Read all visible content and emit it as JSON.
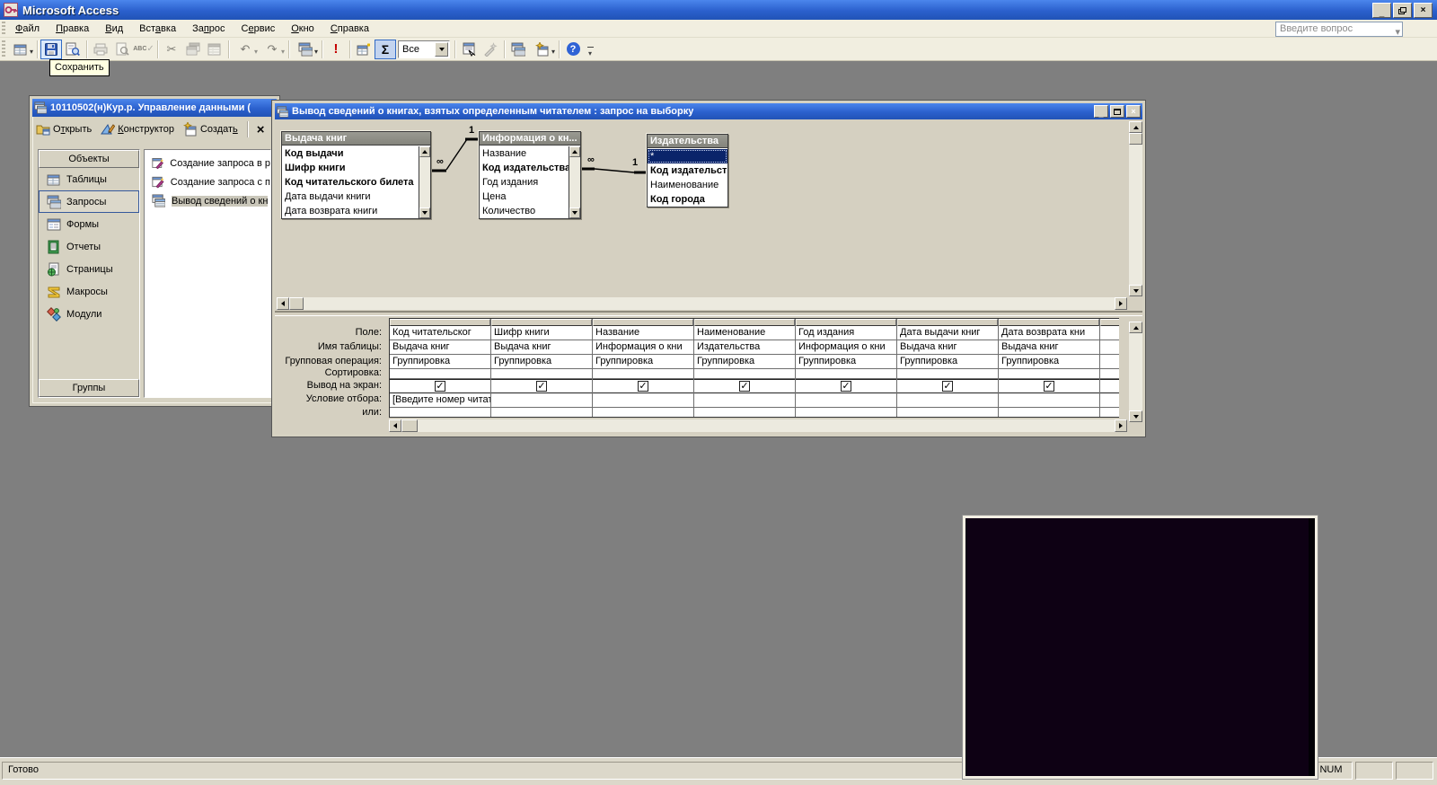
{
  "app": {
    "title": "Microsoft Access",
    "question_box": "Введите вопрос",
    "tooltip_save": "Сохранить",
    "status_ready": "Готово",
    "status_num": "NUM"
  },
  "glyphs": {
    "dropdown": "▾",
    "run": "!",
    "sigma": "Σ",
    "help": "?",
    "cut": "✂",
    "undo": "↶",
    "redo": "↷",
    "close": "×",
    "check": "✓",
    "abc": "ABC"
  },
  "menu": {
    "items": [
      {
        "pre": "",
        "u": "Ф",
        "post": "айл"
      },
      {
        "pre": "",
        "u": "П",
        "post": "равка"
      },
      {
        "pre": "",
        "u": "В",
        "post": "ид"
      },
      {
        "pre": "Вст",
        "u": "а",
        "post": "вка"
      },
      {
        "pre": "За",
        "u": "п",
        "post": "рос"
      },
      {
        "pre": "С",
        "u": "е",
        "post": "рвис"
      },
      {
        "pre": "",
        "u": "О",
        "post": "кно"
      },
      {
        "pre": "",
        "u": "С",
        "post": "правка"
      }
    ]
  },
  "toolbar": {
    "all_combo": "Все"
  },
  "db": {
    "title": "10110502(н)Кур.р. Управление данными (",
    "open_btn": {
      "pre": "О",
      "u": "т",
      "post": "крыть"
    },
    "design_btn": {
      "pre": "",
      "u": "К",
      "post": "онструктор"
    },
    "create_btn": {
      "pre": "Создат",
      "u": "ь",
      "post": ""
    },
    "objects_header": "Объекты",
    "groups_header": "Группы",
    "nav": [
      "Таблицы",
      "Запросы",
      "Формы",
      "Отчеты",
      "Страницы",
      "Макросы",
      "Модули"
    ],
    "items": [
      "Создание запроса в р",
      "Создание запроса с п",
      "Вывод сведений о кн"
    ]
  },
  "query": {
    "title": "Вывод сведений о книгах, взятых определенным читателем : запрос на выборку",
    "join_one": "1",
    "join_many": "∞",
    "tables": [
      {
        "title": "Выдача книг",
        "fields": [
          "Код выдачи",
          "Шифр книги",
          "Код читательского билета",
          "Дата выдачи книги",
          "Дата возврата книги"
        ]
      },
      {
        "title": "Информация о кн...",
        "fields": [
          "Название",
          "Код издательства",
          "Год издания",
          "Цена",
          "Количество"
        ]
      },
      {
        "title": "Издательства",
        "fields": [
          "*",
          "Код издательст",
          "Наименование",
          "Код города"
        ]
      }
    ],
    "grid": {
      "labels": [
        "Поле:",
        "Имя таблицы:",
        "Групповая операция:",
        "Сортировка:",
        "Вывод на экран:",
        "Условие отбора:",
        "или:"
      ],
      "cols": [
        {
          "field": "Код читательског",
          "table": "Выдача книг",
          "group": "Группировка",
          "criteria": "[Введите номер читат"
        },
        {
          "field": "Шифр книги",
          "table": "Выдача книг",
          "group": "Группировка",
          "criteria": ""
        },
        {
          "field": "Название",
          "table": "Информация о кни",
          "group": "Группировка",
          "criteria": ""
        },
        {
          "field": "Наименование",
          "table": "Издательства",
          "group": "Группировка",
          "criteria": ""
        },
        {
          "field": "Год издания",
          "table": "Информация о кни",
          "group": "Группировка",
          "criteria": ""
        },
        {
          "field": "Дата выдачи книг",
          "table": "Выдача книг",
          "group": "Группировка",
          "criteria": ""
        },
        {
          "field": "Дата возврата кни",
          "table": "Выдача книг",
          "group": "Группировка",
          "criteria": ""
        }
      ]
    }
  },
  "colors": {
    "titlebar_blue": "#2b60cd",
    "workspace_gray": "#7f7f7f",
    "chrome_beige": "#d6d2c2",
    "selection_navy": "#0a246a",
    "run_red": "#c40000",
    "hover_blue": "#316ac5"
  }
}
